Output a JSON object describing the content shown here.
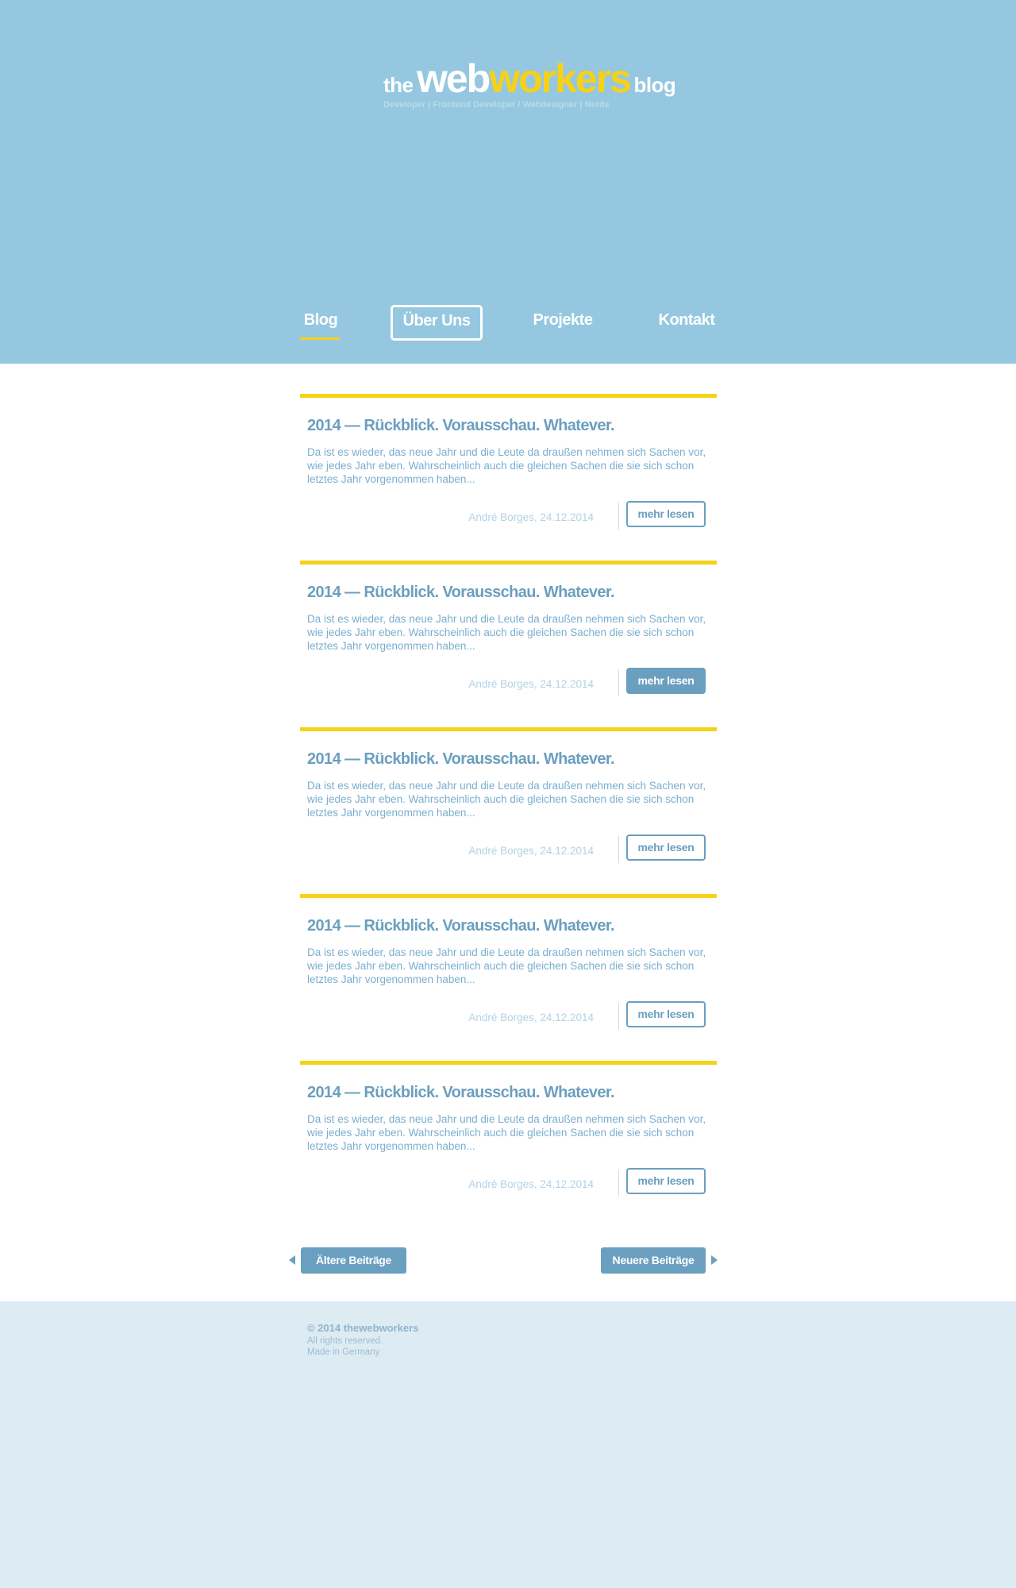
{
  "logo": {
    "the": "the",
    "web": "web",
    "workers": "workers",
    "blog": "blog"
  },
  "tagline": "Developer | Frontend Developer / Webdesigner | Nerds",
  "nav": {
    "blog": "Blog",
    "ueber": "Über Uns",
    "projekte": "Projekte",
    "kontakt": "Kontakt"
  },
  "posts": [
    {
      "title": "2014 — Rückblick. Vorausschau. Whatever.",
      "excerpt": "Da ist es wieder, das neue Jahr und die Leute da draußen nehmen sich Sachen vor, wie jedes Jahr eben. Wahrscheinlich auch die gleichen Sachen die sie sich schon letztes Jahr vorgenommen haben...",
      "meta": "André Borges, 24.12.2014",
      "button": "mehr lesen"
    },
    {
      "title": "2014 — Rückblick. Vorausschau. Whatever.",
      "excerpt": "Da ist es wieder, das neue Jahr und die Leute da draußen nehmen sich Sachen vor, wie jedes Jahr eben. Wahrscheinlich auch die gleichen Sachen die sie sich schon letztes Jahr vorgenommen haben...",
      "meta": "André Borges, 24.12.2014",
      "button": "mehr lesen"
    },
    {
      "title": "2014 — Rückblick. Vorausschau. Whatever.",
      "excerpt": "Da ist es wieder, das neue Jahr und die Leute da draußen nehmen sich Sachen vor, wie jedes Jahr eben. Wahrscheinlich auch die gleichen Sachen die sie sich schon letztes Jahr vorgenommen haben...",
      "meta": "André Borges, 24.12.2014",
      "button": "mehr lesen"
    },
    {
      "title": "2014 — Rückblick. Vorausschau. Whatever.",
      "excerpt": "Da ist es wieder, das neue Jahr und die Leute da draußen nehmen sich Sachen vor, wie jedes Jahr eben. Wahrscheinlich auch die gleichen Sachen die sie sich schon letztes Jahr vorgenommen haben...",
      "meta": "André Borges, 24.12.2014",
      "button": "mehr lesen"
    },
    {
      "title": "2014 — Rückblick. Vorausschau. Whatever.",
      "excerpt": "Da ist es wieder, das neue Jahr und die Leute da draußen nehmen sich Sachen vor, wie jedes Jahr eben. Wahrscheinlich auch die gleichen Sachen die sie sich schon letztes Jahr vorgenommen haben...",
      "meta": "André Borges, 24.12.2014",
      "button": "mehr lesen"
    }
  ],
  "pager": {
    "prev": "Ältere Beiträge",
    "next": "Neuere Beiträge"
  },
  "footer": {
    "copyright": "© 2014 thewebworkers",
    "rights": "All rights reserved.",
    "made": "Made in Germany"
  },
  "colors": {
    "header": "#95c8e0",
    "accent": "#f8d117",
    "link": "#6b9fbf",
    "footer": "#ddebf3"
  },
  "icons": {
    "prev": "triangle-left-icon",
    "next": "triangle-right-icon"
  }
}
